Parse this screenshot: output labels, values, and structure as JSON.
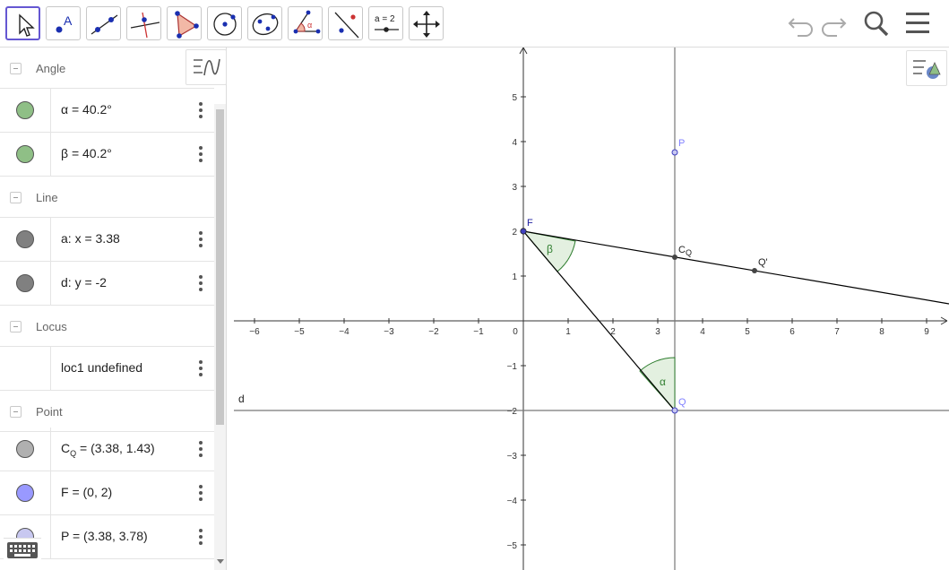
{
  "toolbar": {
    "tools": [
      {
        "id": "move",
        "icon": "arrow-pointer-icon",
        "active": true
      },
      {
        "id": "point",
        "icon": "point-tool-icon",
        "label": "A"
      },
      {
        "id": "line",
        "icon": "line-tool-icon"
      },
      {
        "id": "perpendicular",
        "icon": "perpendicular-line-icon"
      },
      {
        "id": "polygon",
        "icon": "polygon-icon"
      },
      {
        "id": "circle",
        "icon": "circle-center-point-icon"
      },
      {
        "id": "ellipse",
        "icon": "ellipse-icon"
      },
      {
        "id": "angle",
        "icon": "angle-icon",
        "label": "α"
      },
      {
        "id": "reflect",
        "icon": "reflect-point-icon"
      },
      {
        "id": "slider",
        "icon": "slider-icon",
        "label": "a = 2"
      },
      {
        "id": "move-graphics",
        "icon": "move-graphics-view-icon"
      }
    ],
    "undo_icon": "undo-icon",
    "redo_icon": "redo-icon",
    "search_icon": "search-icon",
    "menu_icon": "hamburger-menu-icon"
  },
  "algebra": {
    "sections": [
      {
        "title": "Angle",
        "items": [
          {
            "name": "α",
            "expr": "α = 40.2°",
            "color": "#8fbf86"
          },
          {
            "name": "β",
            "expr": "β = 40.2°",
            "color": "#8fbf86"
          }
        ]
      },
      {
        "title": "Line",
        "items": [
          {
            "name": "a",
            "expr": "a: x = 3.38",
            "color": "#808080"
          },
          {
            "name": "d",
            "expr": "d: y = -2",
            "color": "#808080"
          }
        ]
      },
      {
        "title": "Locus",
        "items": [
          {
            "name": "loc1",
            "expr": "loc1 undefined",
            "color": ""
          }
        ]
      },
      {
        "title": "Point",
        "items": [
          {
            "name": "CQ",
            "expr_main": "C",
            "expr_sub": "Q",
            "expr_rest": " = (3.38, 1.43)",
            "color": "#b0b0b0"
          },
          {
            "name": "F",
            "expr": "F = (0, 2)",
            "color": "#9999ff"
          },
          {
            "name": "P",
            "expr": "P = (3.38, 3.78)",
            "color": "#c8c8f0"
          }
        ]
      }
    ]
  },
  "graphics": {
    "x_ticks": [
      "−6",
      "−5",
      "−4",
      "−3",
      "−2",
      "−1",
      "0",
      "1",
      "2",
      "3",
      "4",
      "5",
      "6",
      "7",
      "8",
      "9"
    ],
    "y_ticks": [
      "5",
      "4",
      "3",
      "2",
      "1",
      "−1",
      "−2",
      "−3",
      "−4",
      "−5"
    ],
    "labels": {
      "F": "F",
      "P": "P",
      "Q": "Q",
      "CQ_main": "C",
      "CQ_sub": "Q",
      "Qprime": "Q'",
      "d": "d",
      "alpha": "α",
      "beta": "β"
    },
    "colors": {
      "point_blue": "#4040c0",
      "point_light": "#8080ff",
      "angle_green": "#2e7d2e",
      "angle_fill": "#e3f0e0",
      "axis": "#333333",
      "line": "#000000",
      "grid_line": "#777777"
    }
  }
}
